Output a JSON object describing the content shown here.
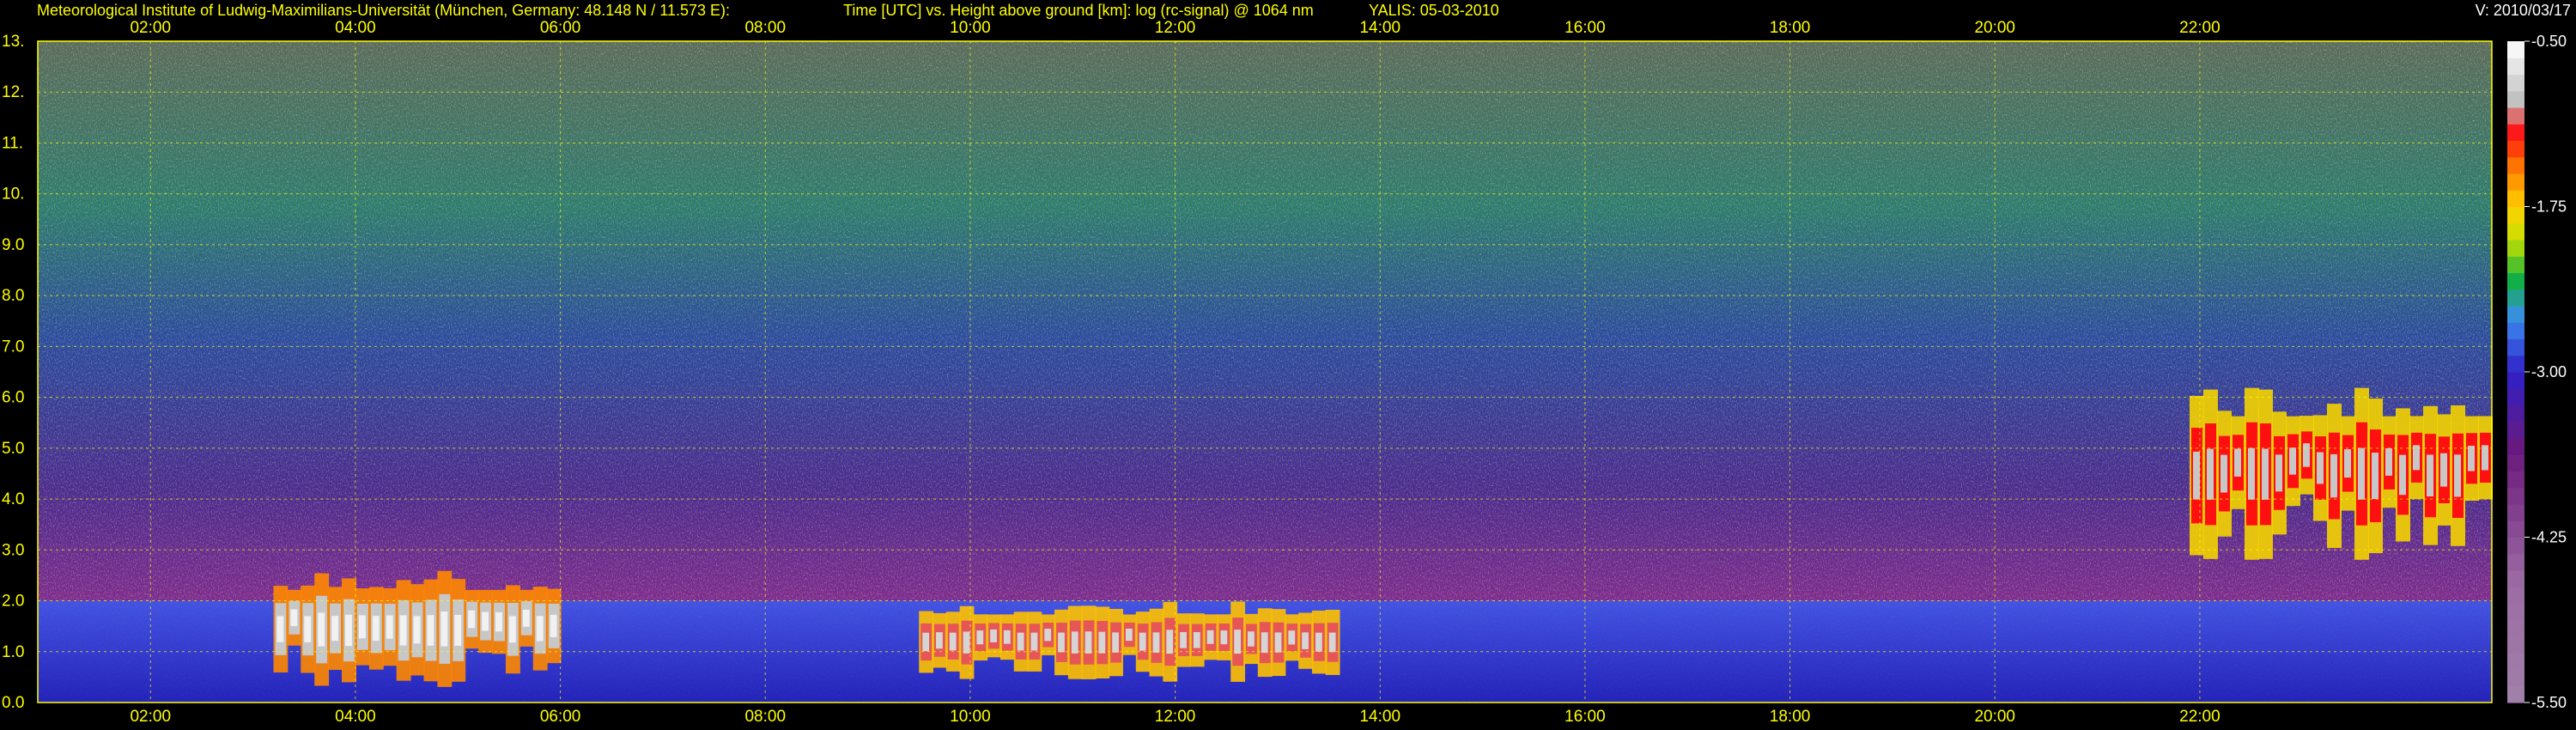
{
  "header": {
    "institute": "Meteorological Institute of Ludwig-Maximilians-Universität (München, Germany: 48.148 N / 11.573 E):",
    "description": "Time [UTC] vs. Height above ground [km]: log (rc-signal) @ 1064 nm",
    "instrument": "YALIS: 05-03-2010",
    "version": "V: 2010/03/17"
  },
  "colors": {
    "background": "#000000",
    "text": "#ffff00",
    "grid": "#ffff00"
  },
  "chart_data": {
    "type": "heatmap",
    "title": "Time [UTC] vs. Height above ground [km]: log (rc-signal) @ 1064 nm",
    "x": {
      "label": "Time [UTC]",
      "range_hours": [
        0.9,
        24.85
      ],
      "ticks": [
        "02:00",
        "04:00",
        "06:00",
        "08:00",
        "10:00",
        "12:00",
        "14:00",
        "16:00",
        "18:00",
        "20:00",
        "22:00"
      ],
      "tick_hours": [
        2,
        4,
        6,
        8,
        10,
        12,
        14,
        16,
        18,
        20,
        22
      ]
    },
    "y": {
      "label": "Height above ground [km]",
      "range": [
        0.0,
        13.0
      ],
      "ticks": [
        "0.0",
        "1.0",
        "2.0",
        "3.0",
        "4.0",
        "5.0",
        "6.0",
        "7.0",
        "8.0",
        "9.0",
        "10.",
        "11.",
        "12.",
        "13."
      ],
      "tick_values": [
        0,
        1,
        2,
        3,
        4,
        5,
        6,
        7,
        8,
        9,
        10,
        11,
        12,
        13
      ]
    },
    "grid": true,
    "colorbar": {
      "ticks": [
        "-0.50",
        "-1.75",
        "-3.00",
        "-4.25",
        "-5.50"
      ],
      "tick_values": [
        -0.5,
        -1.75,
        -3.0,
        -4.25,
        -5.5
      ],
      "range": [
        -5.5,
        -0.5
      ],
      "stops": [
        {
          "value": -5.5,
          "color": "#a080a8"
        },
        {
          "value": -4.6,
          "color": "#9c6ca4"
        },
        {
          "value": -3.6,
          "color": "#6a1a7a"
        },
        {
          "value": -3.0,
          "color": "#3020c8"
        },
        {
          "value": -2.6,
          "color": "#3c8cf0"
        },
        {
          "value": -2.3,
          "color": "#10b040"
        },
        {
          "value": -2.0,
          "color": "#c8e000"
        },
        {
          "value": -1.75,
          "color": "#ffd000"
        },
        {
          "value": -1.45,
          "color": "#ff7800"
        },
        {
          "value": -1.2,
          "color": "#ff1010"
        },
        {
          "value": -0.95,
          "color": "#c0c0c0"
        },
        {
          "value": -0.5,
          "color": "#ffffff"
        }
      ]
    },
    "features": [
      {
        "name": "boundary layer aerosol",
        "time_hours": [
          0.9,
          24.85
        ],
        "height_km": [
          0.0,
          2.0
        ],
        "log_signal": -2.8
      },
      {
        "name": "low cloud",
        "time_hours": [
          3.2,
          6.0
        ],
        "height_km": [
          0.3,
          2.6
        ],
        "log_signal": -0.6
      },
      {
        "name": "low cloud",
        "time_hours": [
          9.5,
          13.6
        ],
        "height_km": [
          0.4,
          2.0
        ],
        "log_signal": -0.8
      },
      {
        "name": "cloud layer",
        "time_hours": [
          21.9,
          24.85
        ],
        "height_km": [
          2.8,
          6.2
        ],
        "log_signal": -0.9
      }
    ]
  }
}
